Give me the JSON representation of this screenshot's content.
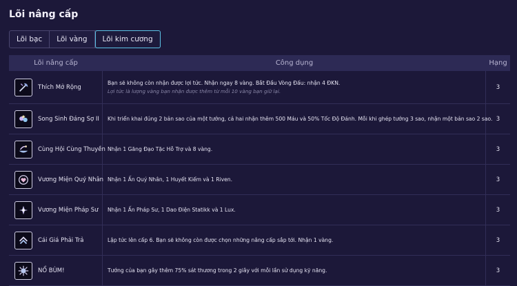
{
  "page": {
    "title": "Lõi nâng cấp"
  },
  "tabs": [
    {
      "label": "Lõi bạc",
      "active": false
    },
    {
      "label": "Lõi vàng",
      "active": false
    },
    {
      "label": "Lõi kim cương",
      "active": true
    }
  ],
  "table": {
    "headers": [
      "Lõi nâng cấp",
      "Công dụng",
      "Hạng"
    ],
    "rows": [
      {
        "name": "Thích Mở Rộng",
        "icon": "axe-icon",
        "desc": "Bạn sẽ không còn nhận được lợi tức. Nhận ngay 8 vàng. Bắt Đầu Vòng Đấu: nhận 4 ĐKN.",
        "note": "Lợi tức là lượng vàng bạn nhận được thêm từ mỗi 10 vàng bạn giữ lại.",
        "rank": "3"
      },
      {
        "name": "Song Sinh Đáng Sợ II",
        "icon": "twin-stars-icon",
        "desc": "Khi triển khai đúng 2 bản sao của một tướng, cả hai nhận thêm 500 Máu và 50% Tốc Độ Đánh. Mỗi khi ghép tướng 3 sao, nhận một bản sao 2 sao.",
        "note": "",
        "rank": "3"
      },
      {
        "name": "Cùng Hội Cùng Thuyền",
        "icon": "boat-icon",
        "desc": "Nhận 1 Găng Đạo Tặc Hỗ Trợ và 8 vàng.",
        "note": "",
        "rank": "3"
      },
      {
        "name": "Vương Miện Quý Nhân",
        "icon": "heart-crown-icon",
        "desc": "Nhận 1 Ấn Quý Nhân, 1 Huyết Kiếm và 1 Riven.",
        "note": "",
        "rank": "3"
      },
      {
        "name": "Vương Miện Pháp Sư",
        "icon": "mage-crown-icon",
        "desc": "Nhận 1 Ấn Pháp Sư, 1 Dao Điện Statikk và 1 Lux.",
        "note": "",
        "rank": "3"
      },
      {
        "name": "Cái Giá Phải Trả",
        "icon": "level-up-icon",
        "desc": "Lập tức lên cấp 6. Bạn sẽ không còn được chọn những nâng cấp sắp tới. Nhận 1 vàng.",
        "note": "",
        "rank": "3"
      },
      {
        "name": "NỔ BÙM!",
        "icon": "explosion-icon",
        "desc": "Tướng của bạn gây thêm 75% sát thương trong 2 giây với mỗi lần sử dụng kỹ năng.",
        "note": "",
        "rank": "3"
      }
    ]
  }
}
